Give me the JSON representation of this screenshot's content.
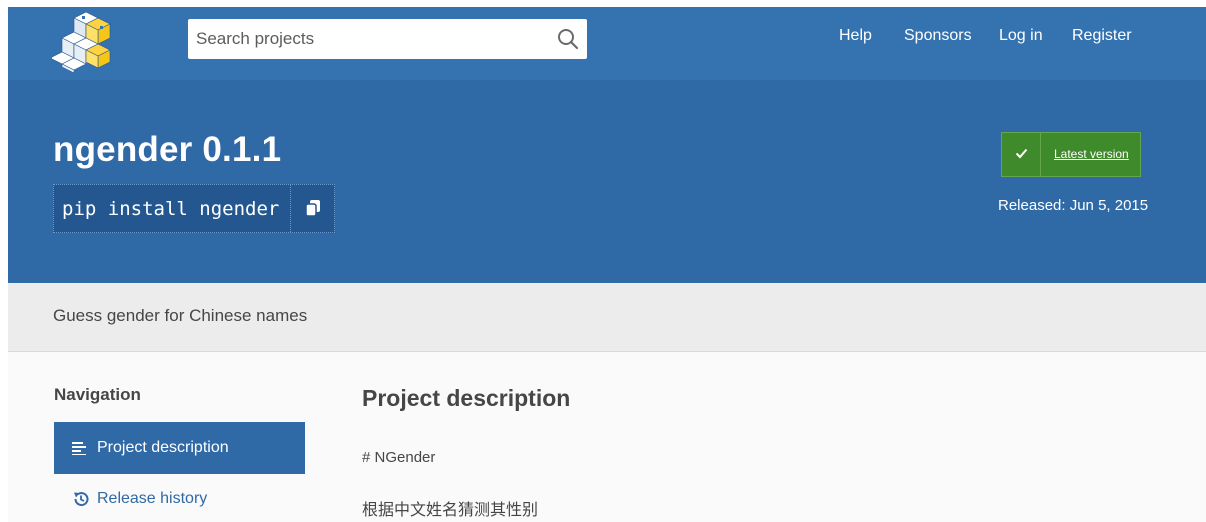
{
  "header": {
    "logo_icon": "pypi-logo-icon",
    "search": {
      "placeholder": "Search projects",
      "icon": "search-icon"
    },
    "nav": [
      {
        "label": "Help"
      },
      {
        "label": "Sponsors"
      },
      {
        "label": "Log in"
      },
      {
        "label": "Register"
      }
    ]
  },
  "package": {
    "title": "ngender 0.1.1",
    "pip_command": "pip install ngender",
    "copy_icon": "copy-icon",
    "latest_label": "Latest version",
    "released": "Released: Jun 5, 2015"
  },
  "summary": "Guess gender for Chinese names",
  "sidebar": {
    "heading": "Navigation",
    "items": [
      {
        "label": "Project description",
        "icon": "list-lines-icon",
        "active": true
      },
      {
        "label": "Release history",
        "icon": "history-icon",
        "active": false
      }
    ]
  },
  "description": {
    "heading": "Project description",
    "lines": [
      "# NGender",
      "根据中文姓名猜测其性别"
    ]
  },
  "colors": {
    "nav_bg": "#3572b0",
    "hero_bg": "#2f6aa7",
    "latest_badge": "#3f8a2a",
    "summary_bg": "#ececec"
  }
}
